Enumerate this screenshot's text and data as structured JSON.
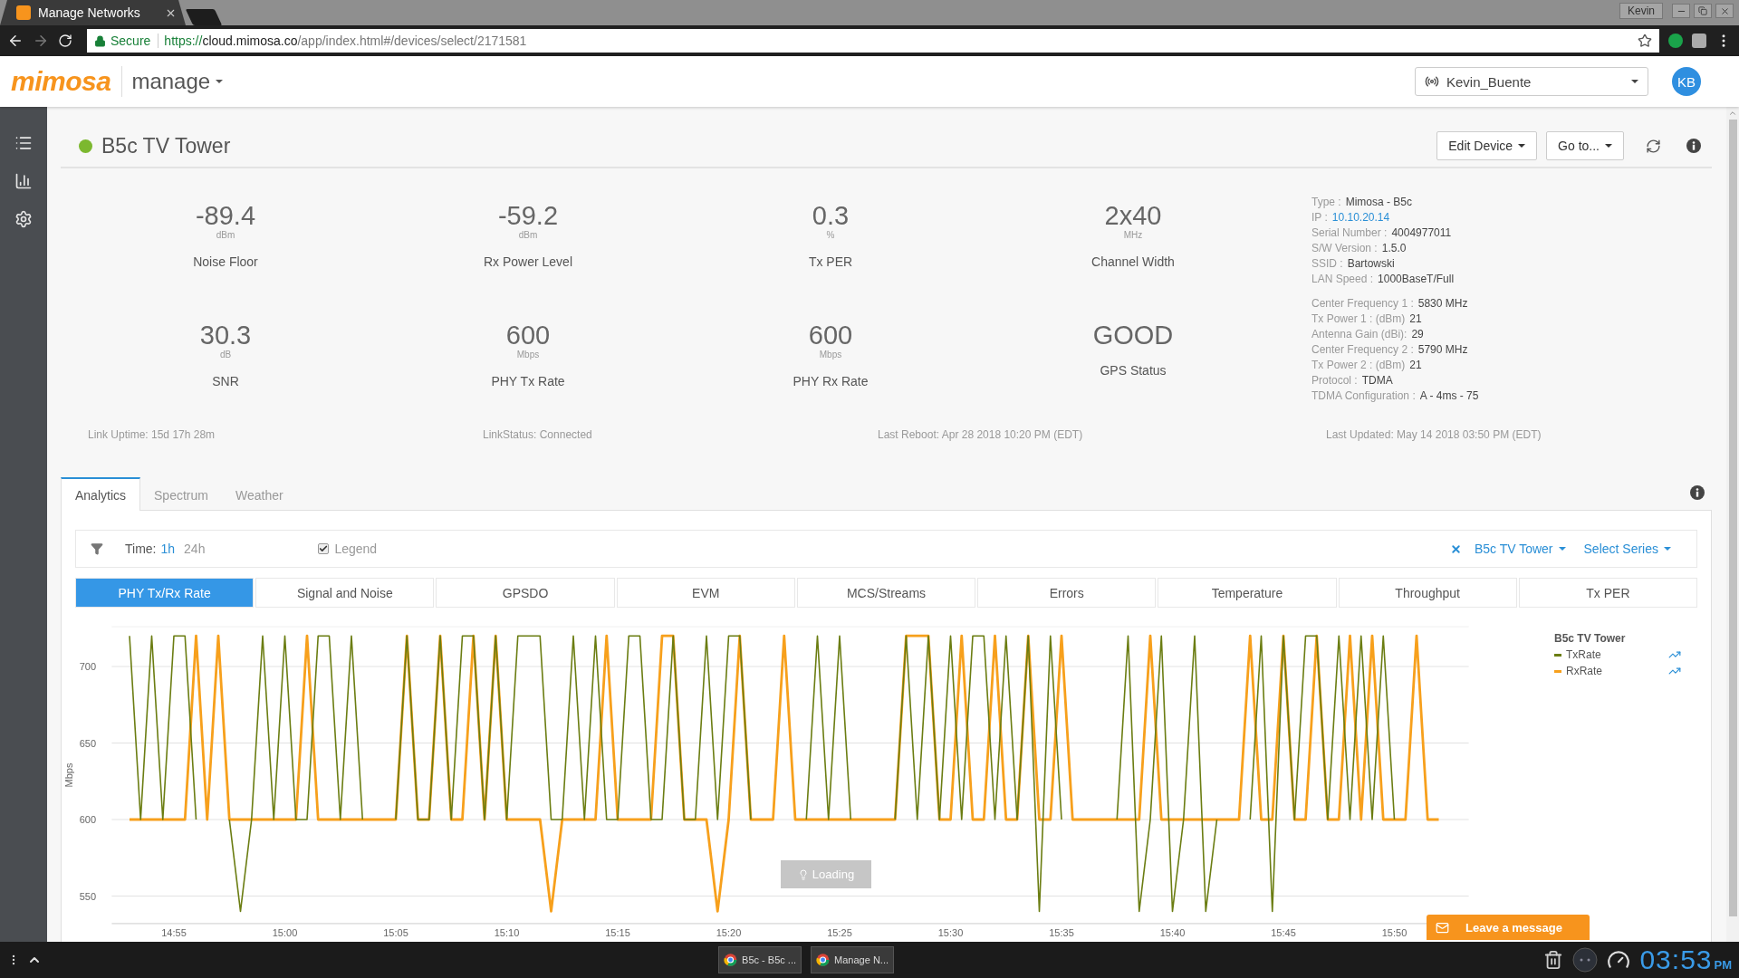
{
  "browser": {
    "tab_title": "Manage Networks",
    "profile": "Kevin",
    "secure_label": "Secure",
    "url_scheme": "https://",
    "url_host": "cloud.mimosa.co",
    "url_path": "/app/index.html#/devices/select/2171581"
  },
  "app_header": {
    "logo": "mimosa",
    "product_menu": "manage",
    "account": "Kevin_Buente",
    "avatar_initials": "KB"
  },
  "device": {
    "name": "B5c TV Tower",
    "buttons": [
      "Edit Device",
      "Go to..."
    ]
  },
  "metrics": [
    {
      "value": "-89.4",
      "unit": "dBm",
      "label": "Noise Floor"
    },
    {
      "value": "-59.2",
      "unit": "dBm",
      "label": "Rx Power Level"
    },
    {
      "value": "0.3",
      "unit": "%",
      "label": "Tx PER"
    },
    {
      "value": "2x40",
      "unit": "MHz",
      "label": "Channel Width"
    },
    {
      "value": "30.3",
      "unit": "dB",
      "label": "SNR"
    },
    {
      "value": "600",
      "unit": "Mbps",
      "label": "PHY Tx Rate"
    },
    {
      "value": "600",
      "unit": "Mbps",
      "label": "PHY Rx Rate"
    },
    {
      "value": "GOOD",
      "label": "GPS Status"
    }
  ],
  "info": {
    "device": [
      {
        "kind": "text",
        "label": "Type :",
        "value": "Mimosa - B5c"
      },
      {
        "kind": "link",
        "label": "IP :",
        "value": "10.10.20.14"
      },
      {
        "kind": "text",
        "label": "Serial Number :",
        "value": "4004977011"
      },
      {
        "kind": "text",
        "label": "S/W Version :",
        "value": "1.5.0"
      },
      {
        "kind": "text",
        "label": "SSID :",
        "value": "Bartowski"
      },
      {
        "kind": "text",
        "label": "LAN Speed :",
        "value": "1000BaseT/Full"
      }
    ],
    "radio": [
      {
        "kind": "text",
        "label": "Center Frequency 1 :",
        "value": "5830 MHz"
      },
      {
        "kind": "text",
        "label": "Tx Power 1 : (dBm)",
        "value": "21"
      },
      {
        "kind": "text",
        "label": "Antenna Gain (dBi):",
        "value": "29"
      },
      {
        "kind": "text",
        "label": "Center Frequency 2 :",
        "value": "5790 MHz"
      },
      {
        "kind": "text",
        "label": "Tx Power 2 : (dBm)",
        "value": "21"
      },
      {
        "kind": "text",
        "label": "Protocol :",
        "value": "TDMA"
      },
      {
        "kind": "text",
        "label": "TDMA Configuration :",
        "value": "A - 4ms - 75"
      }
    ]
  },
  "link_footer": [
    "Link Uptime: 15d 17h 28m",
    "LinkStatus: Connected",
    "Last Reboot: Apr 28 2018 10:20 PM (EDT)",
    "Last Updated: May 14 2018 03:50 PM (EDT)"
  ],
  "tabs": [
    {
      "label": "Analytics",
      "selected": true
    },
    {
      "label": "Spectrum",
      "selected": false
    },
    {
      "label": "Weather",
      "selected": false
    }
  ],
  "toolbar": {
    "time_label": "Time:",
    "ranges": [
      {
        "label": "1h",
        "selected": true
      },
      {
        "label": "24h",
        "selected": false
      }
    ],
    "legend": {
      "label": "Legend",
      "checked": true
    },
    "device_filter": "B5c TV Tower",
    "series_menu": "Select Series"
  },
  "series_tabs": [
    {
      "label": "PHY Tx/Rx Rate",
      "selected": true
    },
    {
      "label": "Signal and Noise",
      "selected": false
    },
    {
      "label": "GPSDO",
      "selected": false
    },
    {
      "label": "EVM",
      "selected": false
    },
    {
      "label": "MCS/Streams",
      "selected": false
    },
    {
      "label": "Errors",
      "selected": false
    },
    {
      "label": "Temperature",
      "selected": false
    },
    {
      "label": "Throughput",
      "selected": false
    },
    {
      "label": "Tx PER",
      "selected": false
    }
  ],
  "chart": {
    "loading_label": "Loading",
    "legend_title": "B5c TV Tower",
    "chart_data": {
      "type": "line",
      "ylabel": "Mbps",
      "grid": true,
      "categories": [
        null,
        null,
        null,
        null,
        "14:55",
        null,
        null,
        null,
        null,
        null,
        null,
        null,
        null,
        null,
        "15:00",
        null,
        null,
        null,
        null,
        null,
        null,
        null,
        null,
        null,
        "15:05",
        null,
        null,
        null,
        null,
        null,
        null,
        null,
        null,
        null,
        "15:10",
        null,
        null,
        null,
        null,
        null,
        null,
        null,
        null,
        null,
        "15:15",
        null,
        null,
        null,
        null,
        null,
        null,
        null,
        null,
        null,
        "15:20",
        null,
        null,
        null,
        null,
        null,
        null,
        null,
        null,
        null,
        "15:25",
        null,
        null,
        null,
        null,
        null,
        null,
        null,
        null,
        null,
        "15:30",
        null,
        null,
        null,
        null,
        null,
        null,
        null,
        null,
        null,
        "15:35",
        null,
        null,
        null,
        null,
        null,
        null,
        null,
        null,
        null,
        "15:40",
        null,
        null,
        null,
        null,
        null,
        null,
        null,
        null,
        null,
        "15:45",
        null,
        null,
        null,
        null,
        null,
        null,
        null,
        null,
        null,
        "15:50",
        null,
        null,
        null,
        null
      ],
      "series": [
        {
          "name": "TxRate",
          "color": "#6b7d12",
          "values": [
            720,
            600,
            720,
            600,
            720,
            720,
            600,
            null,
            null,
            600,
            540,
            600,
            720,
            600,
            720,
            600,
            600,
            720,
            720,
            600,
            720,
            600,
            null,
            null,
            600,
            720,
            600,
            600,
            720,
            600,
            720,
            720,
            600,
            720,
            600,
            720,
            720,
            720,
            600,
            600,
            720,
            600,
            720,
            600,
            600,
            720,
            720,
            600,
            600,
            720,
            600,
            600,
            720,
            600,
            720,
            720,
            600,
            null,
            null,
            null,
            null,
            600,
            720,
            600,
            720,
            600,
            null,
            null,
            null,
            600,
            720,
            600,
            720,
            600,
            720,
            600,
            720,
            720,
            600,
            720,
            600,
            720,
            540,
            720,
            600,
            null,
            null,
            null,
            null,
            600,
            720,
            540,
            600,
            720,
            540,
            600,
            720,
            540,
            600,
            null,
            null,
            600,
            720,
            540,
            720,
            600,
            720,
            720,
            600,
            720,
            600,
            720,
            600,
            720,
            600,
            null,
            null,
            null,
            null
          ]
        },
        {
          "name": "RxRate",
          "color": "#f7a01c",
          "values": [
            600,
            600,
            600,
            600,
            600,
            600,
            720,
            600,
            720,
            600,
            600,
            600,
            600,
            600,
            600,
            600,
            720,
            600,
            600,
            600,
            600,
            600,
            600,
            600,
            600,
            720,
            600,
            600,
            720,
            600,
            600,
            720,
            600,
            720,
            600,
            600,
            600,
            600,
            540,
            600,
            600,
            600,
            600,
            720,
            600,
            600,
            600,
            600,
            720,
            720,
            600,
            600,
            600,
            540,
            600,
            720,
            600,
            600,
            600,
            720,
            600,
            600,
            600,
            600,
            600,
            600,
            600,
            600,
            600,
            600,
            720,
            720,
            720,
            600,
            600,
            720,
            600,
            600,
            720,
            600,
            600,
            720,
            600,
            600,
            720,
            600,
            600,
            600,
            600,
            600,
            600,
            600,
            720,
            600,
            600,
            600,
            600,
            600,
            600,
            600,
            600,
            720,
            600,
            600,
            720,
            600,
            600,
            720,
            600,
            600,
            720,
            600,
            720,
            600,
            600,
            600,
            720,
            600,
            600
          ]
        }
      ],
      "ylim": [
        532,
        726
      ],
      "yticks": [
        550,
        600,
        650,
        700
      ]
    }
  },
  "chat_button": "Leave a message",
  "taskbar": {
    "tasks": [
      "B5c - B5c ...",
      "Manage N..."
    ],
    "clock": "03:53",
    "meridiem": "PM"
  }
}
